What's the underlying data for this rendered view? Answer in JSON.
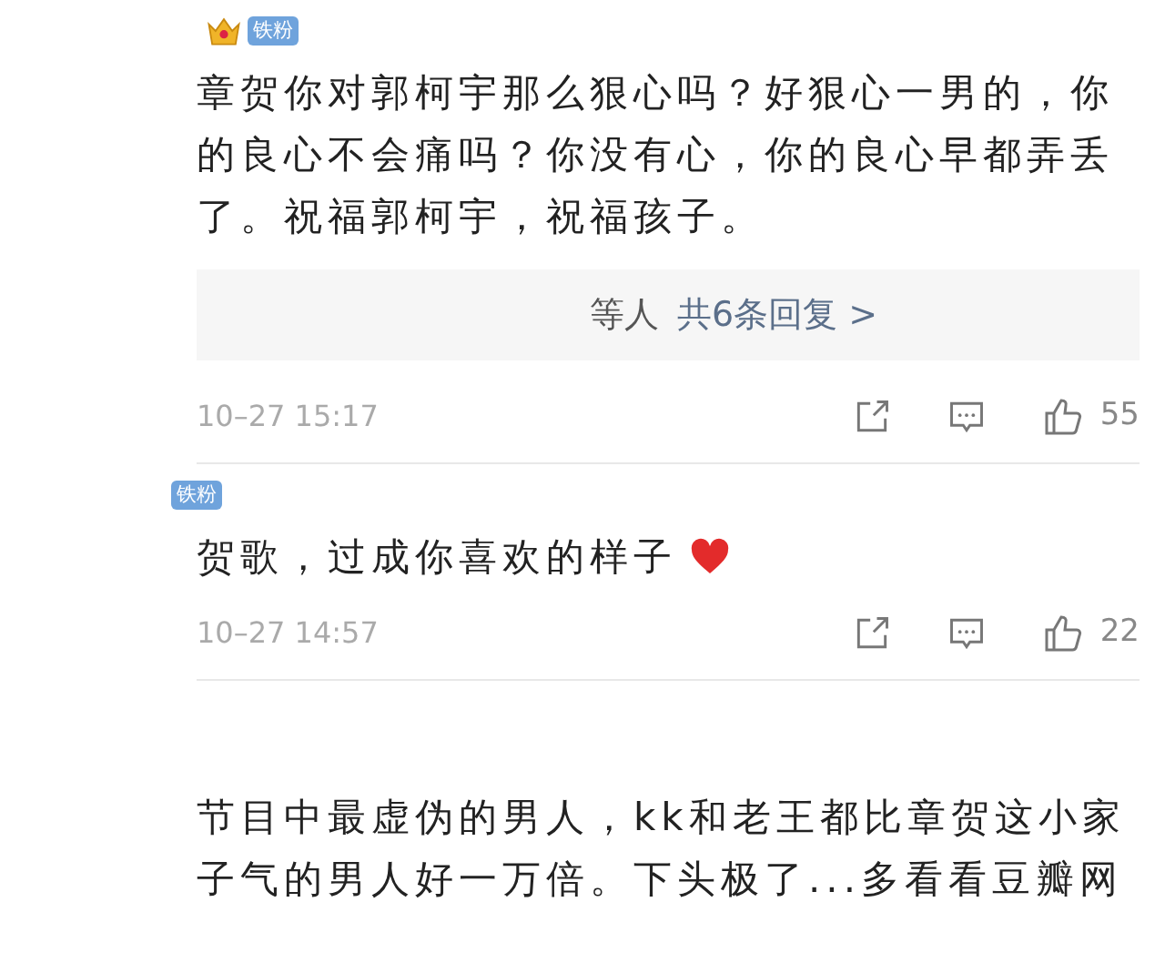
{
  "comments": [
    {
      "badge": {
        "label": "铁粉",
        "crown": true
      },
      "text": "章贺你对郭柯宇那么狠心吗？好狠心一男的，你的良心不会痛吗？你没有心，你的良心早都弄丢了。祝福郭柯宇，祝福孩子。",
      "has_emoji": false,
      "replies": {
        "suffix": "等人",
        "link": "共6条回复 >"
      },
      "time": "10–27 15:17",
      "likes": "55"
    },
    {
      "badge": {
        "label": "铁粉",
        "crown": false
      },
      "text": "贺歌，过成你喜欢的样子",
      "has_emoji": true,
      "time": "10–27 14:57",
      "likes": "22"
    },
    {
      "text": "节目中最虚伪的男人，kk和老王都比章贺这小家子气的男人好一万倍。下头极了...多看看豆瓣网",
      "has_emoji": false
    }
  ]
}
